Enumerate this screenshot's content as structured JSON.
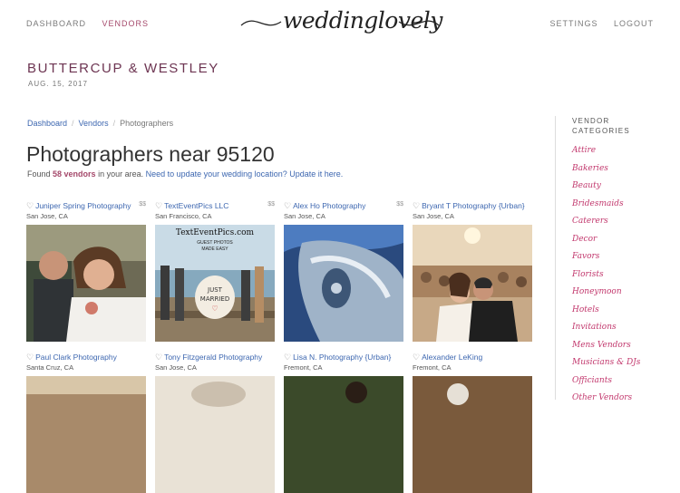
{
  "nav": {
    "left": [
      {
        "label": "Dashboard",
        "active": false
      },
      {
        "label": "Vendors",
        "active": true
      }
    ],
    "right": [
      "Settings",
      "Logout"
    ],
    "logo_text": "weddinglovely"
  },
  "couple": {
    "names": "Buttercup & Westley",
    "date": "Aug. 15, 2017"
  },
  "breadcrumb": {
    "items": [
      "Dashboard",
      "Vendors",
      "Photographers"
    ]
  },
  "page": {
    "title": "Photographers near 95120",
    "found_prefix": "Found ",
    "found_count": "58 vendors",
    "found_suffix": " in your area. ",
    "update_link": "Need to update your wedding location? Update it here."
  },
  "vendors": [
    {
      "name": "Juniper Spring Photography",
      "location": "San Jose, CA",
      "price": "$$"
    },
    {
      "name": "TextEventPics LLC",
      "location": "San Francisco, CA",
      "price": "$$"
    },
    {
      "name": "Alex Ho Photography",
      "location": "San Jose, CA",
      "price": "$$"
    },
    {
      "name": "Bryant T Photography {Urban}",
      "location": "San Jose, CA",
      "price": ""
    },
    {
      "name": "Paul Clark Photography",
      "location": "Santa Cruz, CA",
      "price": ""
    },
    {
      "name": "Tony Fitzgerald Photography",
      "location": "San Jose, CA",
      "price": ""
    },
    {
      "name": "Lisa N. Photography {Urban}",
      "location": "Fremont, CA",
      "price": ""
    },
    {
      "name": "Alexander LeKing",
      "location": "Fremont, CA",
      "price": ""
    }
  ],
  "image_text": {
    "brand": "TextEventPics.com",
    "tagline1": "GUEST PHOTOS",
    "tagline2": "MADE EASY",
    "sign1": "JUST",
    "sign2": "MARRIED"
  },
  "sidebar": {
    "title_line1": "Vendor",
    "title_line2": "Categories",
    "categories": [
      "Attire",
      "Bakeries",
      "Beauty",
      "Bridesmaids",
      "Caterers",
      "Decor",
      "Favors",
      "Florists",
      "Honeymoon",
      "Hotels",
      "Invitations",
      "Mens Vendors",
      "Musicians & DJs",
      "Officiants",
      "Other Vendors"
    ]
  },
  "colors": {
    "accent": "#a5496b",
    "link": "#3d67b0",
    "category": "#c2386d",
    "couple": "#6d3552"
  }
}
